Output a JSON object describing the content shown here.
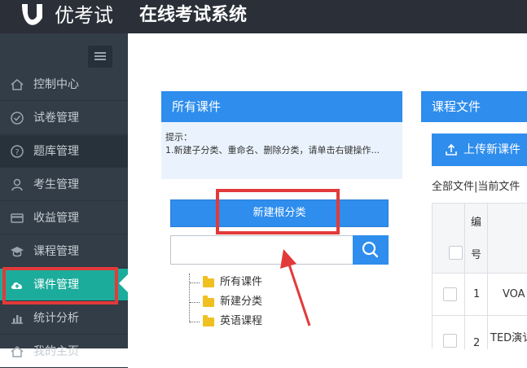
{
  "header": {
    "brand": "优考试",
    "system_title": "在线考试系统"
  },
  "sidebar": {
    "items": [
      {
        "label": "控制中心",
        "icon": "home-icon"
      },
      {
        "label": "试卷管理",
        "icon": "check-circle-icon"
      },
      {
        "label": "题库管理",
        "icon": "question-circle-icon"
      },
      {
        "label": "考生管理",
        "icon": "user-icon"
      },
      {
        "label": "收益管理",
        "icon": "credit-card-icon"
      },
      {
        "label": "课程管理",
        "icon": "graduation-cap-icon"
      },
      {
        "label": "课件管理",
        "icon": "cloud-upload-icon"
      },
      {
        "label": "统计分析",
        "icon": "bar-chart-icon"
      },
      {
        "label": "我的主页",
        "icon": "home-page-icon"
      }
    ],
    "active_item": "课件管理"
  },
  "left_panel": {
    "title": "所有课件",
    "tips_line1": "提示：",
    "tips_line2": "1.新建子分类、重命名、删除分类，请单击右键操作...",
    "new_root_button": "新建根分类",
    "search_placeholder": "",
    "tree": [
      "所有课件",
      "新建分类",
      "英语课程"
    ]
  },
  "right_panel": {
    "title": "课程文件",
    "upload_button": "上传新课件",
    "breadcrumb": "全部文件|当前文件",
    "table": {
      "header_col": [
        "编",
        "号"
      ],
      "rows": [
        {
          "no": "1",
          "name": "VOA"
        },
        {
          "no": "2",
          "name": "TED演讠"
        }
      ]
    }
  },
  "colors": {
    "accent": "#2e8ded",
    "active": "#1cac9c",
    "annotation": "#e23a3a"
  }
}
